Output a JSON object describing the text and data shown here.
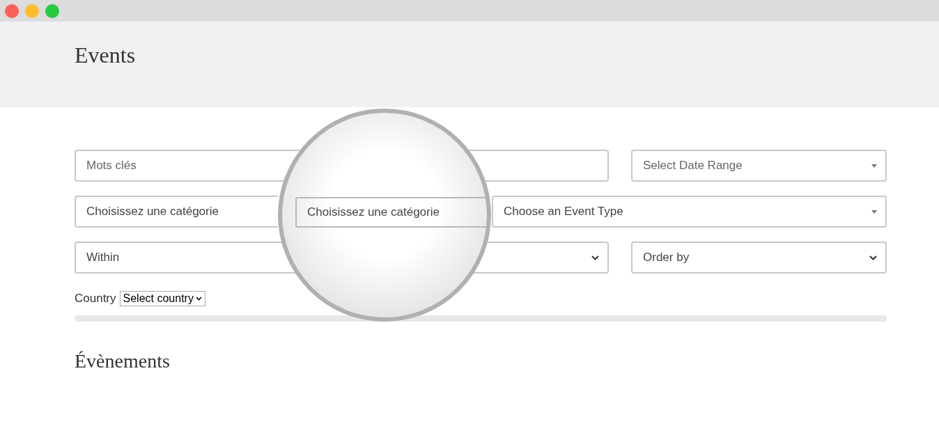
{
  "header": {
    "title": "Events"
  },
  "filters": {
    "keywords": {
      "placeholder": "Mots clés"
    },
    "date_range": {
      "value": "Select Date Range"
    },
    "category": {
      "value": "Choisissez une catégorie"
    },
    "event_type": {
      "value": "Choose an Event Type"
    },
    "within": {
      "value": "Within"
    },
    "order_by": {
      "value": "Order by"
    },
    "country": {
      "label": "Country",
      "value": "Select country"
    }
  },
  "magnifier": {
    "field": {
      "value": "Choisissez une catégorie"
    }
  },
  "section_heading": "Évènements"
}
